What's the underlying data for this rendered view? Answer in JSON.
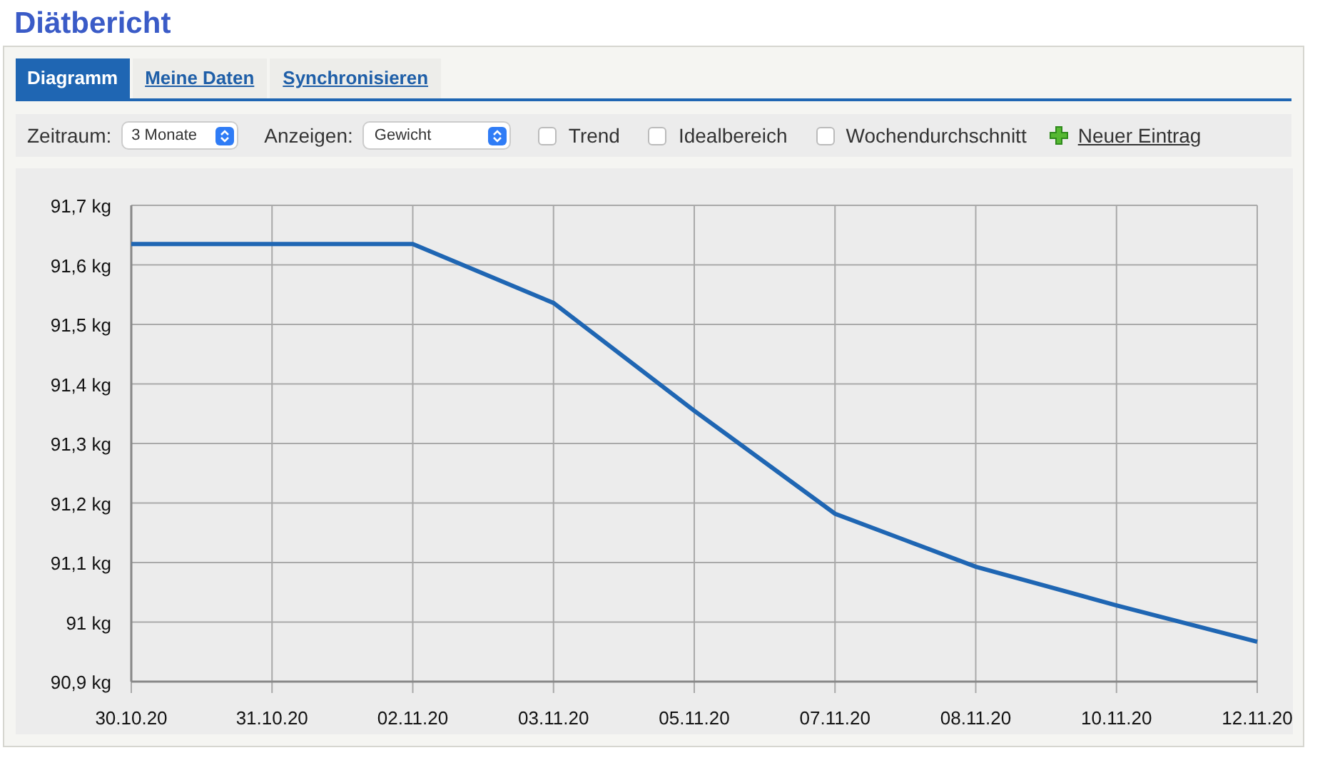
{
  "title": "Diätbericht",
  "tabs": [
    {
      "label": "Diagramm",
      "selected": true
    },
    {
      "label": "Meine Daten",
      "selected": false
    },
    {
      "label": "Synchronisieren",
      "selected": false
    }
  ],
  "toolbar": {
    "period": {
      "label": "Zeitraum:",
      "value": "3 Monate"
    },
    "show": {
      "label": "Anzeigen:",
      "value": "Gewicht"
    },
    "options": [
      {
        "label": "Trend",
        "checked": false
      },
      {
        "label": "Idealbereich",
        "checked": false
      },
      {
        "label": "Wochendurchschnitt",
        "checked": false
      }
    ],
    "new_entry": "Neuer Eintrag"
  },
  "chart_data": {
    "type": "line",
    "categories": [
      "30.10.20",
      "31.10.20",
      "02.11.20",
      "03.11.20",
      "05.11.20",
      "07.11.20",
      "08.11.20",
      "10.11.20",
      "12.11.20"
    ],
    "series": [
      {
        "color": "#1f66b3",
        "values": [
          91.635,
          91.635,
          91.635,
          91.536,
          91.355,
          91.182,
          91.093,
          91.028,
          90.967
        ]
      }
    ],
    "ylim": [
      90.9,
      91.7
    ],
    "grid": true,
    "yticks": [
      {
        "value": 91.7,
        "label": "91,7 kg"
      },
      {
        "value": 91.6,
        "label": "91,6 kg"
      },
      {
        "value": 91.5,
        "label": "91,5 kg"
      },
      {
        "value": 91.4,
        "label": "91,4 kg"
      },
      {
        "value": 91.3,
        "label": "91,3 kg"
      },
      {
        "value": 91.2,
        "label": "91,2 kg"
      },
      {
        "value": 91.1,
        "label": "91,1 kg"
      },
      {
        "value": 91.0,
        "label": "91 kg"
      },
      {
        "value": 90.9,
        "label": "90,9 kg"
      }
    ]
  }
}
